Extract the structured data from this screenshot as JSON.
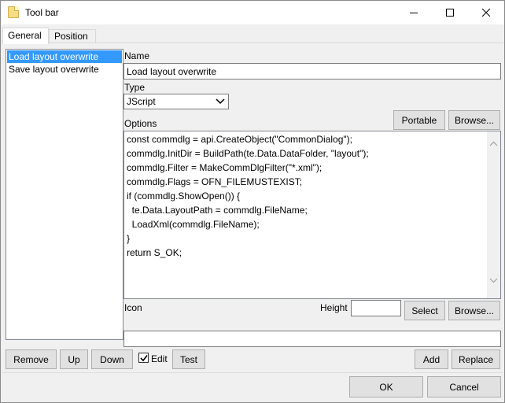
{
  "window": {
    "title": "Tool bar",
    "icon": "folder-icon"
  },
  "tabs": [
    {
      "label": "General",
      "active": true
    },
    {
      "label": "Position",
      "active": false
    }
  ],
  "list": {
    "items": [
      {
        "label": "Load layout overwrite",
        "selected": true
      },
      {
        "label": "Save layout overwrite",
        "selected": false
      }
    ]
  },
  "form": {
    "name_label": "Name",
    "name_value": "Load layout overwrite",
    "type_label": "Type",
    "type_value": "JScript",
    "options_label": "Options",
    "portable_button": "Portable",
    "browse_button": "Browse...",
    "code_lines": [
      "const commdlg = api.CreateObject(\"CommonDialog\");",
      "commdlg.InitDir = BuildPath(te.Data.DataFolder, \"layout\");",
      "commdlg.Filter = MakeCommDlgFilter(\"*.xml\");",
      "commdlg.Flags = OFN_FILEMUSTEXIST;",
      "if (commdlg.ShowOpen()) {",
      "  te.Data.LayoutPath = commdlg.FileName;",
      "  LoadXml(commdlg.FileName);",
      "}",
      "return S_OK;"
    ],
    "icon_label": "Icon",
    "height_label": "Height",
    "height_value": "",
    "select_button": "Select",
    "icon_browse_button": "Browse...",
    "icon_path_value": ""
  },
  "actions": {
    "remove": "Remove",
    "up": "Up",
    "down": "Down",
    "edit_label": "Edit",
    "edit_checked": true,
    "test": "Test",
    "add": "Add",
    "replace": "Replace"
  },
  "footer": {
    "ok": "OK",
    "cancel": "Cancel"
  },
  "colors": {
    "selection": "#3399ff",
    "button_face": "#e1e1e1",
    "dialog_bg": "#f0f0f0"
  }
}
